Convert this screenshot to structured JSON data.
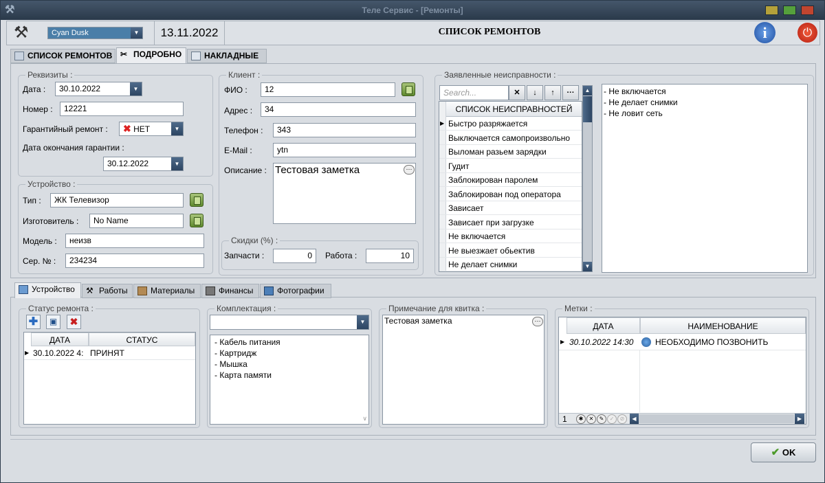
{
  "window": {
    "title": "Теле Сервис - [Ремонты]"
  },
  "header": {
    "theme": "Cyan Dusk",
    "date": "13.11.2022",
    "title": "СПИСОК РЕМОНТОВ"
  },
  "tabs": [
    "СПИСОК РЕМОНТОВ",
    "ПОДРОБНО",
    "НАКЛАДНЫЕ"
  ],
  "details": {
    "title": "Реквизиты :",
    "date_label": "Дата :",
    "date": "30.10.2022",
    "number_label": "Номер :",
    "number": "12221",
    "warranty_label": "Гарантийный ремонт :",
    "warranty": "НЕТ",
    "warranty_end_label": "Дата окончания гарантии :",
    "warranty_end": "30.12.2022"
  },
  "device": {
    "title": "Устройство :",
    "type_label": "Тип :",
    "type": "ЖК Телевизор",
    "maker_label": "Изготовитель :",
    "maker": "No Name",
    "model_label": "Модель :",
    "model": "неизв",
    "serial_label": "Сер. № :",
    "serial": "234234"
  },
  "client": {
    "title": "Клиент :",
    "fio_label": "ФИО :",
    "fio": "12",
    "address_label": "Адрес :",
    "address": "34",
    "phone_label": "Телефон :",
    "phone": "343",
    "email_label": "E-Mail :",
    "email": "ytn",
    "desc_label": "Описание :",
    "desc": "Тестовая заметка"
  },
  "discounts": {
    "title": "Скидки (%) :",
    "parts_label": "Запчасти :",
    "parts": "0",
    "work_label": "Работа :",
    "work": "10"
  },
  "faults": {
    "title": "Заявленные неисправности :",
    "search_placeholder": "Search...",
    "col": "СПИСОК НЕИСПРАВНОСТЕЙ",
    "items": [
      "Быстро разряжается",
      "Выключается самопроизвольно",
      "Выломан разьем зарядки",
      "Гудит",
      "Заблокирован паролем",
      "Заблокирован под оператора",
      "Зависает",
      "Зависает при загрузке",
      "Не включается",
      "Не выезжает обьектив",
      "Не делает снимки"
    ],
    "selected": [
      "- Не включается",
      "- Не делает снимки",
      "- Не ловит сеть"
    ]
  },
  "bottom_tabs": [
    "Устройство",
    "Работы",
    "Материалы",
    "Финансы",
    "Фотографии"
  ],
  "status": {
    "title": "Статус ремонта :",
    "col_date": "ДАТА",
    "col_status": "СТАТУС",
    "rows": [
      {
        "date": "30.10.2022 4:",
        "status": "ПРИНЯТ"
      }
    ]
  },
  "kit": {
    "title": "Комплектация :",
    "items": [
      "- Кабель питания",
      "- Картридж",
      "- Мышка",
      "- Карта памяти"
    ]
  },
  "receipt": {
    "title": "Примечание для квитка :",
    "text": "Тестовая заметка"
  },
  "marks": {
    "title": "Метки :",
    "col_date": "ДАТА",
    "col_name": "НАИМЕНОВАНИЕ",
    "rows": [
      {
        "date": "30.10.2022 14:30",
        "name": "НЕОБХОДИМО ПОЗВОНИТЬ"
      }
    ],
    "count": "1"
  },
  "ok_label": "OK"
}
